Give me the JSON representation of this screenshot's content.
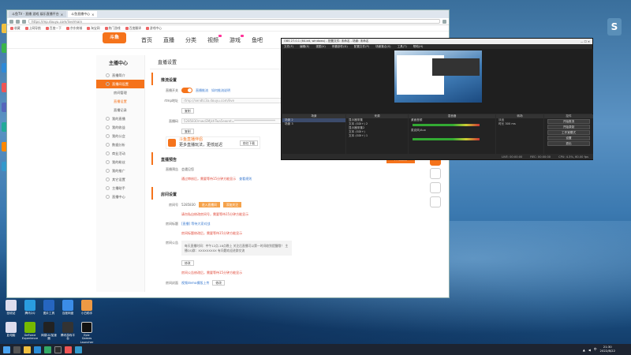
{
  "browser": {
    "tabs": [
      "斗鱼TV - 直播 游戏 娱乐直播平台",
      "斗鱼直播中心"
    ],
    "url": "https://mp.douyu.com/live/main",
    "bookmarks": [
      "收藏",
      "上网导航",
      "百度一下",
      "京东商城",
      "淘宝网",
      "热门游戏",
      "百度翻译",
      "游戏中心"
    ]
  },
  "site": {
    "logo": "斗鱼",
    "nav": [
      "首页",
      "直播",
      "分类",
      "视频",
      "游戏",
      "鱼吧"
    ]
  },
  "sidebar": {
    "title": "主播中心",
    "items": [
      {
        "label": "直播简介"
      },
      {
        "label": "直播间设置",
        "active": true
      },
      {
        "label": "房间管理",
        "sub": true
      },
      {
        "label": "直播设置",
        "sub": true,
        "on": true
      },
      {
        "label": "直播记录",
        "sub": true
      },
      {
        "label": "我的直播"
      },
      {
        "label": "我的收益"
      },
      {
        "label": "我的公会"
      },
      {
        "label": "数据分析"
      },
      {
        "label": "商业活动"
      },
      {
        "label": "我的粉丝"
      },
      {
        "label": "我的推广"
      },
      {
        "label": "其它设置"
      },
      {
        "label": "主播助手"
      },
      {
        "label": "直播中心"
      }
    ]
  },
  "main": {
    "crumb": "直播设置",
    "s1": "推流设置",
    "push_label": "直播开关",
    "link1": "直播推流",
    "link2": "如何推流说明",
    "rtmp_label": "rtmp地址",
    "rtmp_value": "rtmp://sendtc3a.douyu.com/live",
    "copy": "复制",
    "key_label": "直播码",
    "key_value": "5285830rnwcEMjkhTwa5ewret=**************************",
    "promo_title": "斗鱼直播伴侣",
    "promo_sub": "更多直播玩法，更低延迟",
    "promo_btn": "前往下载",
    "s2": "直播预告",
    "notice_label": "直播预告",
    "notice_value": "会遇见您",
    "notice_warn": "通过审核后，需要等待15分钟方能显示",
    "notice_link": "查看规则",
    "s3": "房间设置",
    "room_label": "房间号",
    "room_value": "5285830",
    "room_btn1": "进入直播间",
    "room_btn2": "添加关注",
    "room_warn": "请勿私自修改房间号，需要等待15分钟方能显示",
    "title_label": "房间标题",
    "title_value": "[直播] 等待大家对战",
    "title_warn": "房间标题修改后，需要等待15分钟方能显示",
    "intro_label": "房间公告",
    "intro_text": "每天直播时间：中午12点-18点晚上 关注后直播可以第一时间收到提醒哦！ 主播QQ群：XXXXXXXXX 有问题欢迎进群交流",
    "save": "修改",
    "cover_warn": "房间公告修改后，需要等待15分钟方能显示",
    "cover_label": "房间封面",
    "cover_link": "视频demo模版上传",
    "cover_btn": "修改",
    "start_btn": "开始直播"
  },
  "obs": {
    "title": "OBS 27.0.1 (64-bit, windows) - 配置文件: 未命名 - 场景: 未命名",
    "menu": [
      "文件(F)",
      "编辑(E)",
      "视图(V)",
      "停靠部件(D)",
      "配置文件(P)",
      "场景集合(S)",
      "工具(T)",
      "帮助(H)"
    ],
    "docks": [
      "场景",
      "来源",
      "混音器",
      "转场",
      "控件"
    ],
    "scenes": [
      "场景 2",
      "场景 3"
    ],
    "sources": [
      "显示器采集",
      "文本 (GDI+) 2",
      "显示器采集2",
      "文本 (GDI+)",
      "文本 (GDI+) 1"
    ],
    "mixer": [
      "桌面音频",
      "麦克风/Aux"
    ],
    "transition": "淡出",
    "duration_label": "时长",
    "duration": "300 ms",
    "controls": [
      "开始推流",
      "开始录制",
      "工作室模式",
      "设置",
      "退出"
    ],
    "status": [
      "LIVE: 00:00:00",
      "REC: 00:00:00",
      "CPU: 4.3%, 60.00 fps"
    ]
  },
  "desktop": {
    "icons": [
      {
        "label": "回收站"
      },
      {
        "label": "腾讯QQ"
      },
      {
        "label": "图片工具"
      },
      {
        "label": "百度网盘"
      },
      {
        "label": "小白助手"
      }
    ],
    "icons2": [
      {
        "label": "此电脑"
      },
      {
        "label": "GeForce Experience"
      },
      {
        "label": "网易UU加速器"
      },
      {
        "label": "腾讯游戏平台"
      },
      {
        "label": "Epic Games Launcher"
      }
    ]
  },
  "taskbar": {
    "time": "21:30",
    "date": "2022/8/22"
  }
}
